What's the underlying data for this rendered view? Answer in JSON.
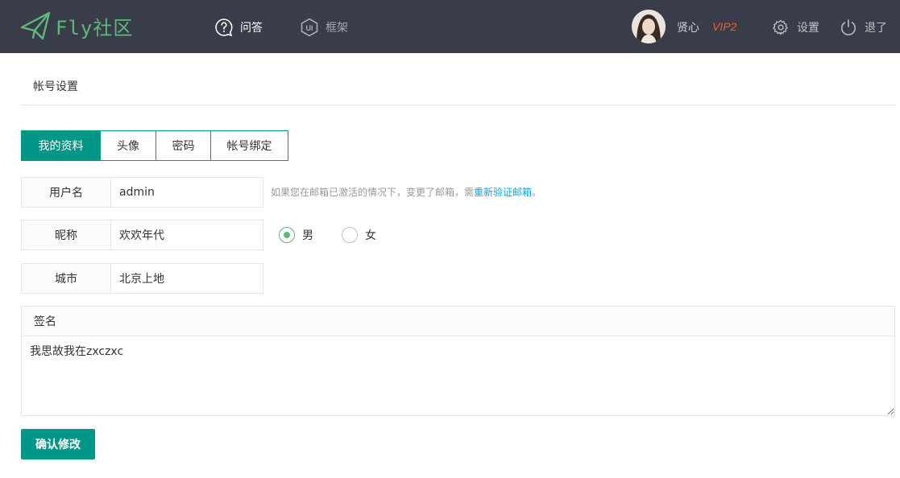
{
  "header": {
    "logo_text": "Fly社区",
    "nav": [
      {
        "label": "问答",
        "icon": "question-bubble-icon"
      },
      {
        "label": "框架",
        "icon": "ui-logo-icon"
      }
    ],
    "user": {
      "name": "贤心",
      "vip": "VIP2"
    },
    "settings_label": "设置",
    "logout_label": "退了"
  },
  "page": {
    "title": "帐号设置"
  },
  "tabs": [
    {
      "label": "我的资料",
      "active": true
    },
    {
      "label": "头像",
      "active": false
    },
    {
      "label": "密码",
      "active": false
    },
    {
      "label": "帐号绑定",
      "active": false
    }
  ],
  "form": {
    "username": {
      "label": "用户名",
      "value": "admin"
    },
    "hint": {
      "text": "如果您在邮箱已激活的情况下，变更了邮箱，需",
      "link": "重新验证邮箱",
      "end": "。"
    },
    "nickname": {
      "label": "昵称",
      "value": "欢欢年代"
    },
    "gender": [
      {
        "label": "男",
        "checked": true
      },
      {
        "label": "女",
        "checked": false
      }
    ],
    "city": {
      "label": "城市",
      "value": "北京上地"
    },
    "signature": {
      "label": "签名",
      "value": "我思故我在zxczxc"
    },
    "submit_label": "确认修改"
  },
  "colors": {
    "header_bg": "#393d49",
    "accent": "#009688",
    "logo_green": "#5fb878",
    "vip": "#ff5722",
    "link": "#01aaed"
  }
}
